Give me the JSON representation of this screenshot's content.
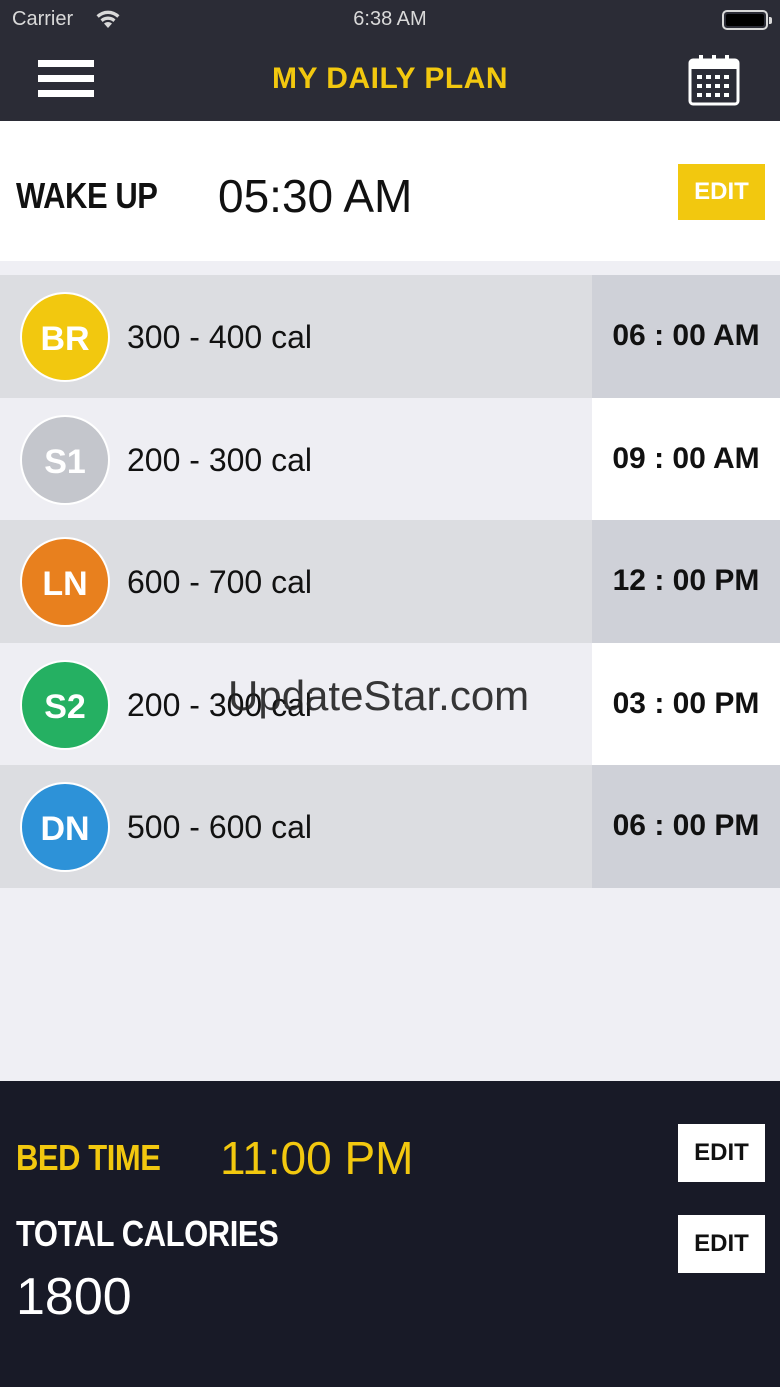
{
  "status_bar": {
    "carrier": "Carrier",
    "time": "6:38 AM"
  },
  "nav": {
    "title": "MY DAILY PLAN",
    "menu_icon": "hamburger-menu-icon",
    "calendar_icon": "calendar-icon"
  },
  "wake_up": {
    "label": "WAKE UP",
    "time": "05:30 AM",
    "edit_label": "EDIT"
  },
  "meals": [
    {
      "code": "BR",
      "calories": "300 - 400 cal",
      "time": "06 : 00 AM",
      "color": "#f2c80f"
    },
    {
      "code": "S1",
      "calories": "200 - 300 cal",
      "time": "09 : 00 AM",
      "color": "#c4c6cc"
    },
    {
      "code": "LN",
      "calories": "600 - 700 cal",
      "time": "12 : 00 PM",
      "color": "#e8801e"
    },
    {
      "code": "S2",
      "calories": "200 - 300 cal",
      "time": "03 : 00 PM",
      "color": "#25b062"
    },
    {
      "code": "DN",
      "calories": "500 - 600 cal",
      "time": "06 : 00 PM",
      "color": "#2d92d8"
    }
  ],
  "watermark": "UpdateStar.com",
  "bed_time": {
    "label": "BED TIME",
    "time": "11:00 PM",
    "edit_label": "EDIT"
  },
  "total_calories": {
    "label": "TOTAL CALORIES",
    "value": "1800",
    "edit_label": "EDIT"
  },
  "colors": {
    "accent": "#f2c80f",
    "nav_bg": "#2b2c36",
    "bottom_bg": "#181a27"
  }
}
